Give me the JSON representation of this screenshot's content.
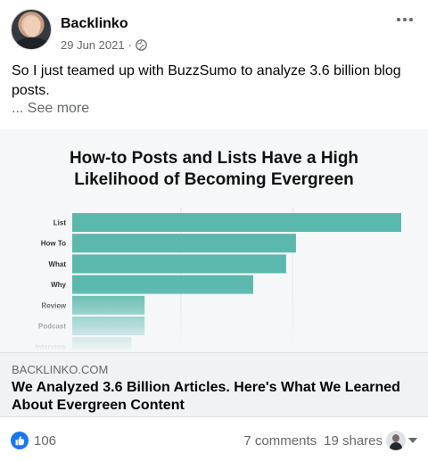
{
  "post": {
    "author": "Backlinko",
    "date": "29 Jun 2021",
    "separator": "·",
    "audience_icon": "globe-icon",
    "more_icon": "more-icon",
    "text": "So I just teamed up with BuzzSumo to analyze 3.6 billion blog posts.",
    "see_more": "... See more"
  },
  "chart_data": {
    "type": "bar",
    "title": "How-to Posts and Lists Have a High Likelihood of Becoming Evergreen",
    "categories": [
      "List",
      "How To",
      "What",
      "Why",
      "Review",
      "Podcast",
      "Interview"
    ],
    "values": [
      100,
      68,
      65,
      55,
      22,
      22,
      18
    ],
    "xlabel": "",
    "ylabel": "",
    "grid": true,
    "color": "#5bb8ad"
  },
  "link": {
    "domain": "BACKLINKO.COM",
    "title": "We Analyzed 3.6 Billion Articles. Here's What We Learned About Evergreen Content"
  },
  "engagement": {
    "like_count": "106",
    "comments": "7 comments",
    "shares": "19 shares",
    "like_color": "#1877f2",
    "viewer_icon": "avatar",
    "caret_icon": "caret-down-icon"
  }
}
